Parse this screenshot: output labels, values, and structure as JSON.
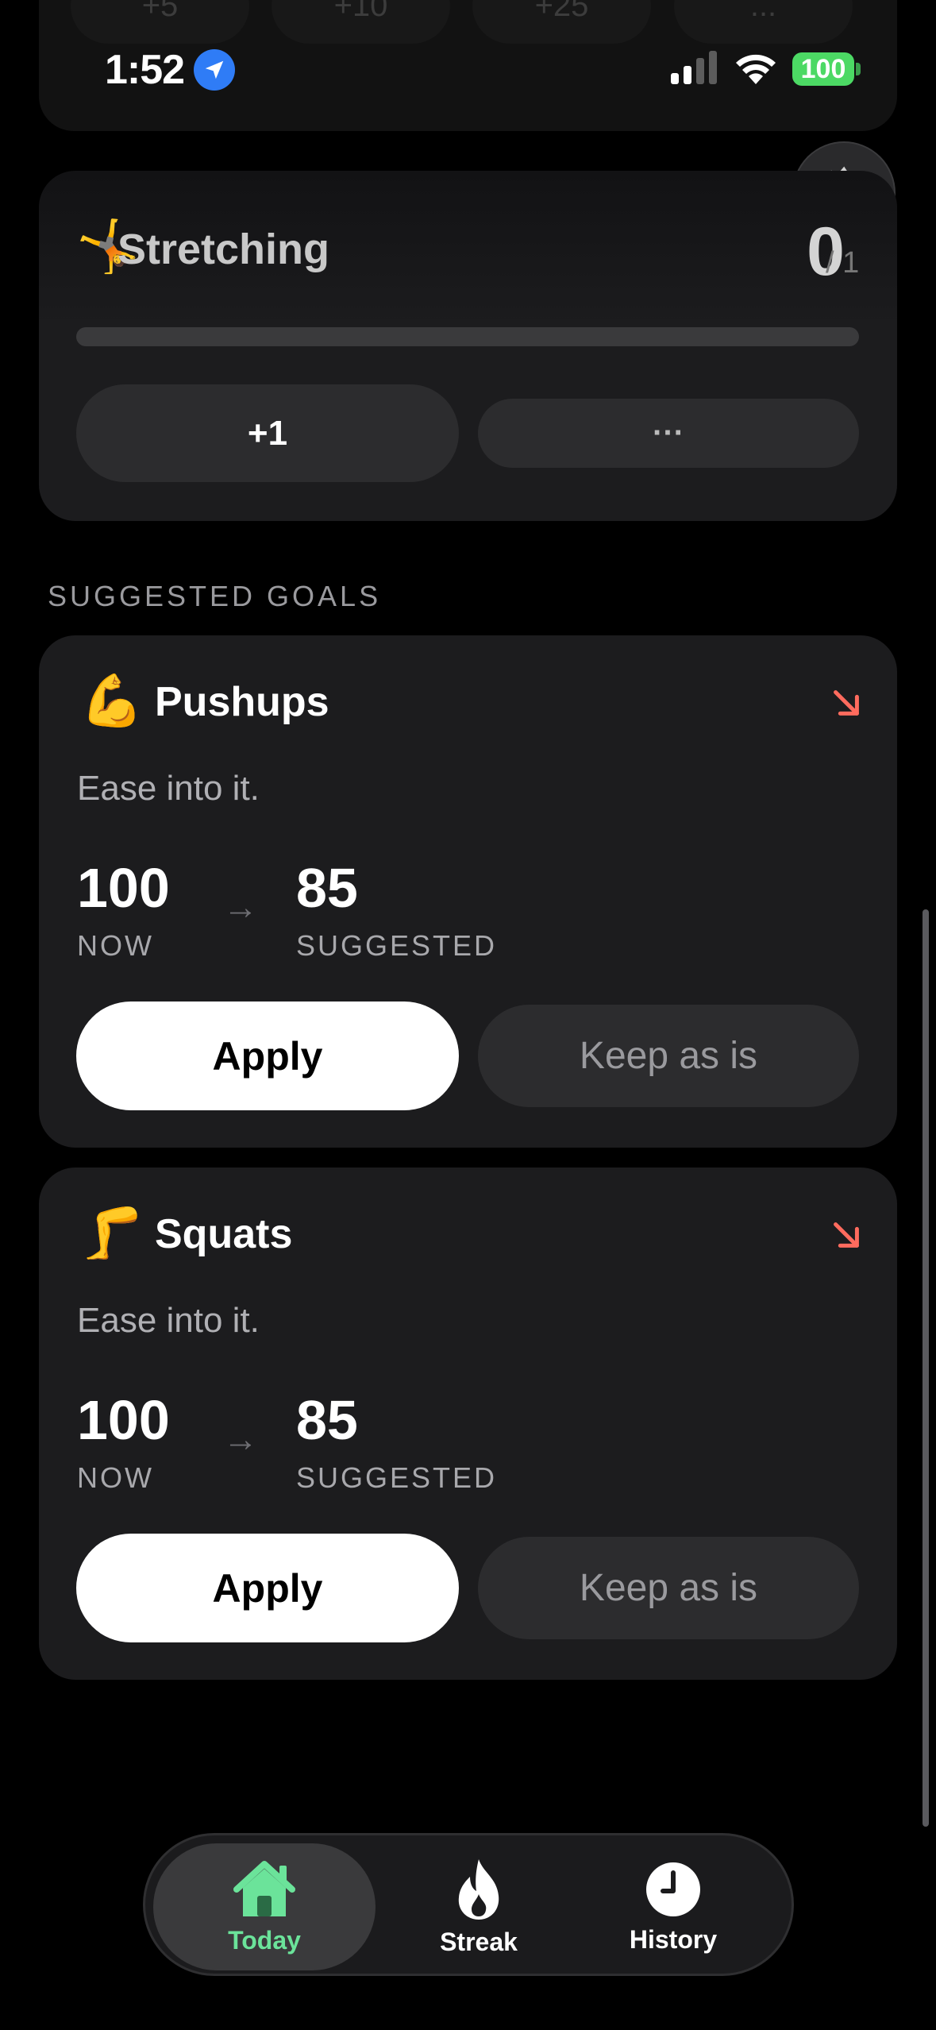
{
  "status_bar": {
    "time": "1:52",
    "battery": "100"
  },
  "top_card": {
    "chips": [
      "+5",
      "+10",
      "+25",
      "..."
    ]
  },
  "stretching": {
    "emoji": "🤸",
    "title": "Stretching",
    "count": "0",
    "target": "/ 1",
    "progress": 0,
    "increment_label": "+1",
    "more_label": "···"
  },
  "section_label": "SUGGESTED GOALS",
  "suggestions": [
    {
      "emoji": "💪",
      "title": "Pushups",
      "description": "Ease into it.",
      "now_value": "100",
      "now_label": "NOW",
      "suggested_value": "85",
      "suggested_label": "SUGGESTED",
      "apply_label": "Apply",
      "keep_label": "Keep as is"
    },
    {
      "emoji": "🦵",
      "title": "Squats",
      "description": "Ease into it.",
      "now_value": "100",
      "now_label": "NOW",
      "suggested_value": "85",
      "suggested_label": "SUGGESTED",
      "apply_label": "Apply",
      "keep_label": "Keep as is"
    }
  ],
  "tabs": [
    {
      "label": "Today",
      "icon": "house-icon",
      "active": true
    },
    {
      "label": "Streak",
      "icon": "flame-icon",
      "active": false
    },
    {
      "label": "History",
      "icon": "clock-icon",
      "active": false
    }
  ],
  "colors": {
    "accent_green": "#6be39a",
    "trend_red": "#ff6b5e",
    "card_bg": "#1c1c1e"
  }
}
